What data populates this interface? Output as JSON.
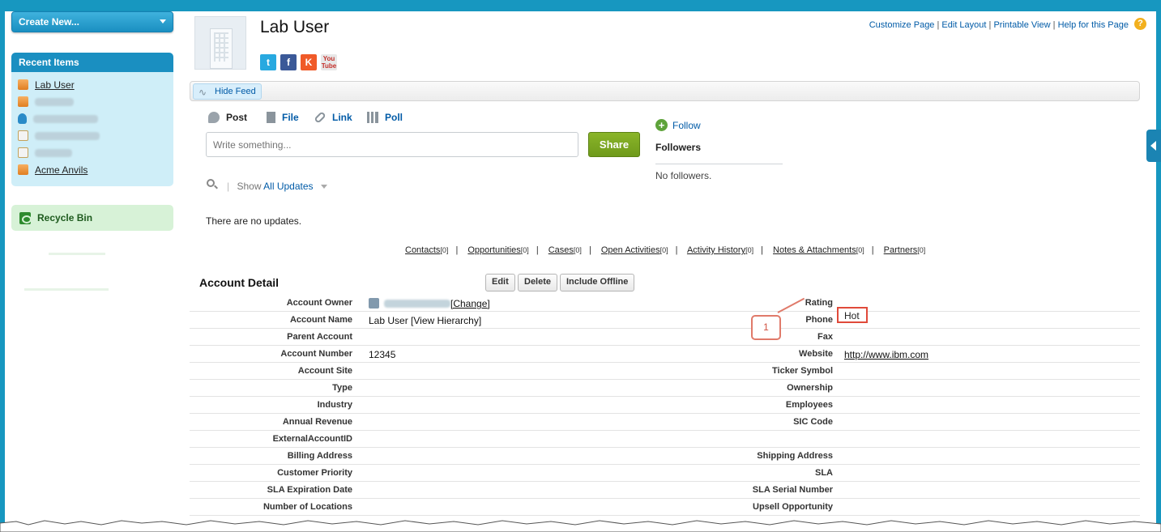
{
  "sidebar": {
    "create_new": "Create New...",
    "recent_title": "Recent Items",
    "recent_items": [
      {
        "label": "Lab User",
        "type": "account",
        "blurred": false
      },
      {
        "label": "",
        "type": "account",
        "blurred": true
      },
      {
        "label": "",
        "type": "contact",
        "blurred": true
      },
      {
        "label": "",
        "type": "document",
        "blurred": true
      },
      {
        "label": "",
        "type": "document",
        "blurred": true
      },
      {
        "label": "Acme Anvils",
        "type": "account",
        "blurred": false
      }
    ],
    "recycle_bin": "Recycle Bin"
  },
  "header": {
    "title": "Lab User",
    "links": [
      "Customize Page",
      "Edit Layout",
      "Printable View",
      "Help for this Page"
    ],
    "help_icon": "?",
    "social": [
      "twitter-icon",
      "facebook-icon",
      "klout-icon",
      "youtube-icon"
    ],
    "social_glyphs": {
      "twitter": "t",
      "facebook": "f",
      "klout": "K",
      "youtube": "You Tube"
    }
  },
  "feed": {
    "hide_feed": "Hide Feed",
    "tabs": [
      "Post",
      "File",
      "Link",
      "Poll"
    ],
    "input_placeholder": "Write something...",
    "share": "Share",
    "show_label": "Show",
    "show_value": "All Updates",
    "no_updates": "There are no updates.",
    "follow": "Follow",
    "followers_title": "Followers",
    "no_followers": "No followers."
  },
  "related_lists": [
    {
      "label": "Contacts",
      "count": "[0]"
    },
    {
      "label": "Opportunities",
      "count": "[0]"
    },
    {
      "label": "Cases",
      "count": "[0]"
    },
    {
      "label": "Open Activities",
      "count": "[0]"
    },
    {
      "label": "Activity History",
      "count": "[0]"
    },
    {
      "label": "Notes & Attachments",
      "count": "[0]"
    },
    {
      "label": "Partners",
      "count": "[0]"
    }
  ],
  "detail": {
    "title": "Account Detail",
    "buttons": [
      "Edit",
      "Delete",
      "Include Offline"
    ],
    "rows": [
      {
        "l1": "Account Owner",
        "v1": "[Change]",
        "l2": "Rating",
        "v2": ""
      },
      {
        "l1": "Account Name",
        "v1": "Lab User [View Hierarchy]",
        "l2": "Phone",
        "v2": ""
      },
      {
        "l1": "Parent Account",
        "v1": "",
        "l2": "Fax",
        "v2": ""
      },
      {
        "l1": "Account Number",
        "v1": "12345",
        "l2": "Website",
        "v2": "http://www.ibm.com"
      },
      {
        "l1": "Account Site",
        "v1": "",
        "l2": "Ticker Symbol",
        "v2": ""
      },
      {
        "l1": "Type",
        "v1": "",
        "l2": "Ownership",
        "v2": ""
      },
      {
        "l1": "Industry",
        "v1": "",
        "l2": "Employees",
        "v2": ""
      },
      {
        "l1": "Annual Revenue",
        "v1": "",
        "l2": "SIC Code",
        "v2": ""
      },
      {
        "l1": "ExternalAccountID",
        "v1": "",
        "l2": "",
        "v2": ""
      },
      {
        "l1": "Billing Address",
        "v1": "",
        "l2": "Shipping Address",
        "v2": ""
      },
      {
        "l1": "Customer Priority",
        "v1": "",
        "l2": "SLA",
        "v2": ""
      },
      {
        "l1": "SLA Expiration Date",
        "v1": "",
        "l2": "SLA Serial Number",
        "v2": ""
      },
      {
        "l1": "Number of Locations",
        "v1": "",
        "l2": "Upsell Opportunity",
        "v2": ""
      }
    ],
    "rating_value": "Hot",
    "callout_number": "1"
  },
  "colors": {
    "brand_blue": "#1797c0",
    "link_blue": "#015ba7",
    "share_green": "#7aa823",
    "callout_red": "#e04a3a"
  }
}
